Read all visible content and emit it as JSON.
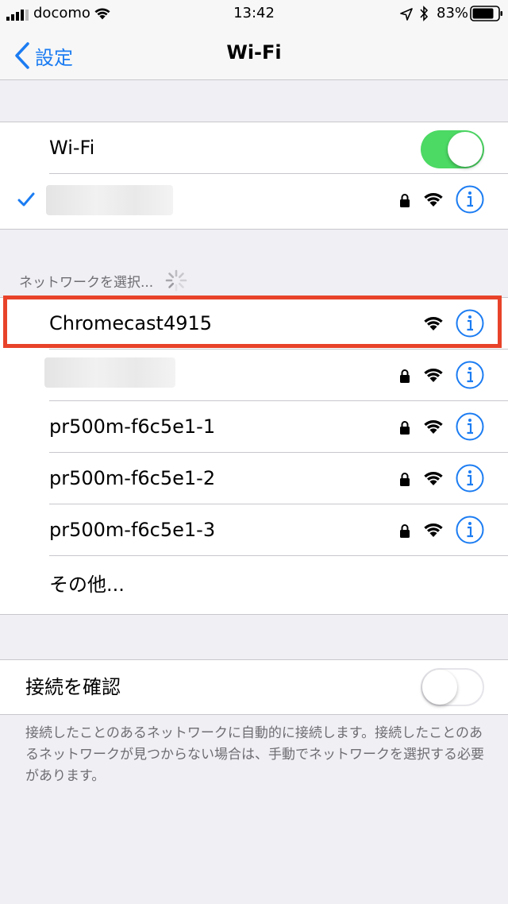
{
  "status_bar": {
    "carrier": "docomo",
    "time": "13:42",
    "battery_percent": "83%"
  },
  "nav": {
    "back_label": "設定",
    "title": "Wi-Fi"
  },
  "wifi_toggle": {
    "label": "Wi-Fi",
    "on": true
  },
  "connected_network": {
    "name": "",
    "secured": true,
    "connected": true
  },
  "section_header": "ネットワークを選択...",
  "networks": [
    {
      "name": "Chromecast4915",
      "secured": false
    },
    {
      "name": "",
      "secured": true
    },
    {
      "name": "pr500m-f6c5e1-1",
      "secured": true
    },
    {
      "name": "pr500m-f6c5e1-2",
      "secured": true
    },
    {
      "name": "pr500m-f6c5e1-3",
      "secured": true
    }
  ],
  "other_label": "その他...",
  "ask_to_join": {
    "label": "接続を確認",
    "on": false
  },
  "footer_note": "接続したことのあるネットワークに自動的に接続します。接続したことのあるネットワークが見つからない場合は、手動でネットワークを選択する必要があります。",
  "colors": {
    "accent": "#1b7cf2",
    "toggle_on": "#4cd964",
    "highlight": "#e8432a",
    "background": "#efeff4"
  }
}
